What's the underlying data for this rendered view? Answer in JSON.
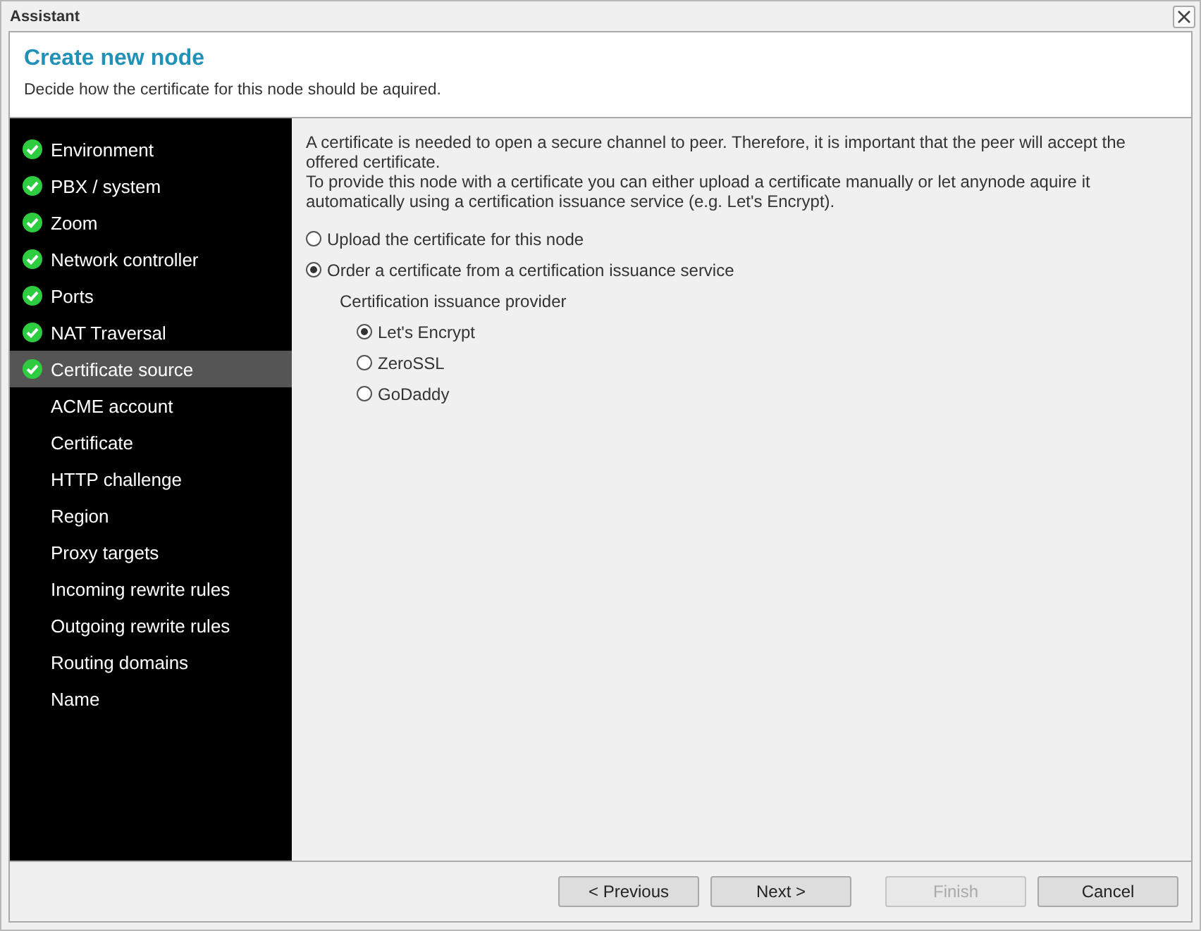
{
  "window": {
    "title": "Assistant"
  },
  "header": {
    "title": "Create new node",
    "subtitle": "Decide how the certificate for this node should be aquired."
  },
  "steps": [
    {
      "label": "Environment",
      "done": true,
      "selected": false
    },
    {
      "label": "PBX / system",
      "done": true,
      "selected": false
    },
    {
      "label": "Zoom",
      "done": true,
      "selected": false
    },
    {
      "label": "Network controller",
      "done": true,
      "selected": false
    },
    {
      "label": "Ports",
      "done": true,
      "selected": false
    },
    {
      "label": "NAT Traversal",
      "done": true,
      "selected": false
    },
    {
      "label": "Certificate source",
      "done": true,
      "selected": true
    },
    {
      "label": "ACME account",
      "done": false,
      "selected": false
    },
    {
      "label": "Certificate",
      "done": false,
      "selected": false
    },
    {
      "label": "HTTP challenge",
      "done": false,
      "selected": false
    },
    {
      "label": "Region",
      "done": false,
      "selected": false
    },
    {
      "label": "Proxy targets",
      "done": false,
      "selected": false
    },
    {
      "label": "Incoming rewrite rules",
      "done": false,
      "selected": false
    },
    {
      "label": "Outgoing rewrite rules",
      "done": false,
      "selected": false
    },
    {
      "label": "Routing domains",
      "done": false,
      "selected": false
    },
    {
      "label": "Name",
      "done": false,
      "selected": false
    }
  ],
  "intro": [
    "A certificate is needed to open a secure channel to peer. Therefore, it is important that the peer will accept the offered certificate.",
    "To provide this node with a certificate you can either upload a certificate manually or let anynode aquire it automatically using a certification issuance service (e.g. Let's Encrypt)."
  ],
  "source_options": [
    {
      "label": "Upload the certificate for this node",
      "selected": false
    },
    {
      "label": "Order a certificate from a certification issuance service",
      "selected": true
    }
  ],
  "provider": {
    "label": "Certification issuance provider",
    "options": [
      {
        "label": "Let's Encrypt",
        "selected": true
      },
      {
        "label": "ZeroSSL",
        "selected": false
      },
      {
        "label": "GoDaddy",
        "selected": false
      }
    ]
  },
  "buttons": [
    {
      "label": "< Previous",
      "disabled": false
    },
    {
      "label": "Next >",
      "disabled": false
    },
    {
      "label": "Finish",
      "disabled": true
    },
    {
      "label": "Cancel",
      "disabled": false
    }
  ]
}
